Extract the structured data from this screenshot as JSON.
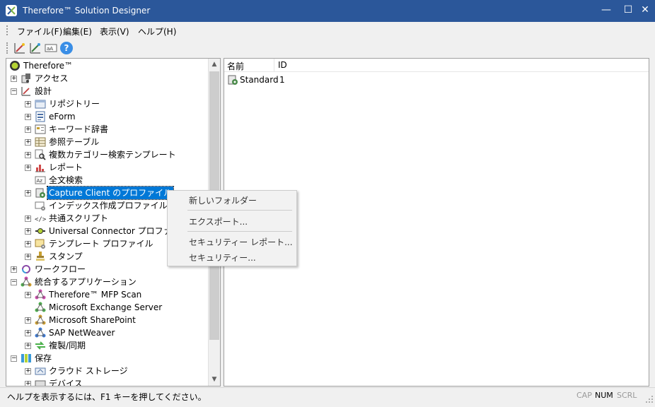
{
  "window": {
    "title": "Therefore™ Solution Designer",
    "min_glyph": "—",
    "max_glyph": "☐",
    "close_glyph": "✕"
  },
  "menu": {
    "file": "ファイル(F)",
    "edit": "編集(E)",
    "view": "表示(V)",
    "help": "ヘルプ(H)"
  },
  "toolbar": {
    "help_glyph": "?"
  },
  "tree": {
    "root": "Therefore™",
    "access": "アクセス",
    "design": "設計",
    "repository": "リポジトリー",
    "eform": "eForm",
    "keyword_dict": "キーワード辞書",
    "ref_table": "参照テーブル",
    "multi_cat_search": "複数カテゴリー検索テンプレート",
    "report": "レポート",
    "fulltext": "全文検索",
    "capture_client": "Capture Client のプロファイル",
    "index_profile": "インデックス作成プロファイル",
    "common_script": "共通スクリプト",
    "universal_connector": "Universal Connector プロファイル",
    "template_profile": "テンプレート プロファイル",
    "stamp": "スタンプ",
    "workflow": "ワークフロー",
    "integrated_apps": "統合するアプリケーション",
    "mfp_scan": "Therefore™ MFP Scan",
    "exchange": "Microsoft Exchange Server",
    "sharepoint": "Microsoft SharePoint",
    "sap": "SAP NetWeaver",
    "replication": "複製/同期",
    "storage": "保存",
    "cloud_storage": "クラウド ストレージ",
    "device": "デバイス"
  },
  "list": {
    "col_name": "名前",
    "col_id": "ID",
    "rows": [
      {
        "name": "Standard",
        "id": "1"
      }
    ]
  },
  "context_menu": {
    "new_folder": "新しいフォルダー",
    "export": "エクスポート...",
    "security_report": "セキュリティー レポート...",
    "security": "セキュリティー..."
  },
  "status": {
    "text": "ヘルプを表示するには、F1 キーを押してください。",
    "cap": "CAP",
    "num": "NUM",
    "scrl": "SCRL"
  },
  "colors": {
    "titlebar": "#2b579a",
    "selection": "#0078d7"
  }
}
